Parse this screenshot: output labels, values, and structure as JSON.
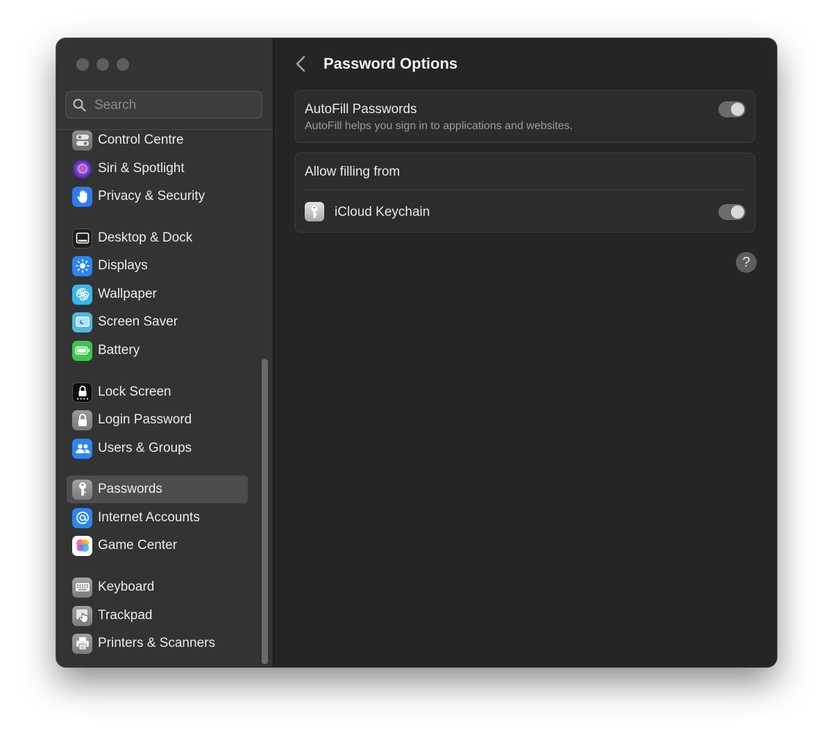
{
  "sidebar": {
    "search_placeholder": "Search",
    "items": [
      {
        "label": "Control Centre",
        "icon": "control-centre-icon"
      },
      {
        "label": "Siri & Spotlight",
        "icon": "siri-icon"
      },
      {
        "label": "Privacy & Security",
        "icon": "hand-icon"
      },
      {
        "label": "Desktop & Dock",
        "icon": "dock-icon"
      },
      {
        "label": "Displays",
        "icon": "sun-icon"
      },
      {
        "label": "Wallpaper",
        "icon": "flower-icon"
      },
      {
        "label": "Screen Saver",
        "icon": "screen-saver-icon"
      },
      {
        "label": "Battery",
        "icon": "battery-icon"
      },
      {
        "label": "Lock Screen",
        "icon": "lock-screen-icon"
      },
      {
        "label": "Login Password",
        "icon": "padlock-icon"
      },
      {
        "label": "Users & Groups",
        "icon": "users-icon"
      },
      {
        "label": "Passwords",
        "icon": "key-icon",
        "selected": true
      },
      {
        "label": "Internet Accounts",
        "icon": "at-sign-icon"
      },
      {
        "label": "Game Center",
        "icon": "game-center-icon"
      },
      {
        "label": "Keyboard",
        "icon": "keyboard-icon"
      },
      {
        "label": "Trackpad",
        "icon": "trackpad-icon"
      },
      {
        "label": "Printers & Scanners",
        "icon": "printer-icon"
      }
    ]
  },
  "main": {
    "title": "Password Options",
    "autofill": {
      "title": "AutoFill Passwords",
      "subtitle": "AutoFill helps you sign in to applications and websites.",
      "enabled": true
    },
    "allow_filling": {
      "header": "Allow filling from",
      "items": [
        {
          "label": "iCloud Keychain",
          "icon": "keychain-key-icon",
          "enabled": true
        }
      ]
    },
    "help_label": "?"
  },
  "colors": {
    "window_bg": "#252525",
    "sidebar_bg": "#333333",
    "selected_bg": "#4d4d4d",
    "toggle_track": "#6b6b6b"
  }
}
